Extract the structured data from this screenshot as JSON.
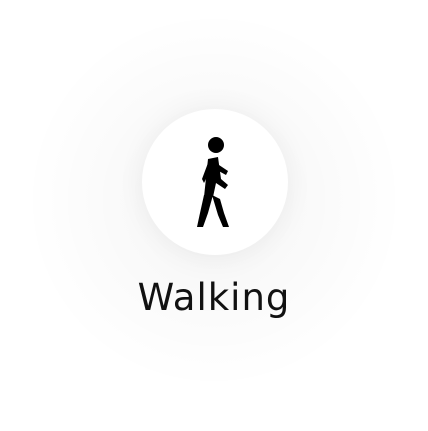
{
  "activity": {
    "label": "Walking",
    "icon": "walking-person-icon"
  },
  "colors": {
    "icon": "#000000",
    "text": "#111111",
    "background": "#ffffff"
  }
}
